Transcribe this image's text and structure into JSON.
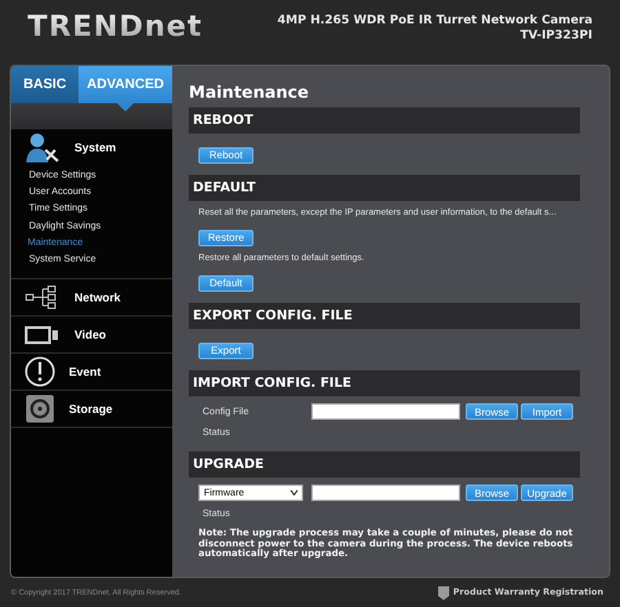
{
  "header": {
    "logo": "TRENDnet",
    "product_name": "4MP H.265 WDR PoE IR Turret Network Camera",
    "model": "TV-IP323PI"
  },
  "mode_tabs": [
    {
      "label": "BASIC",
      "selected": false
    },
    {
      "label": "ADVANCED",
      "selected": true
    }
  ],
  "sidebar": [
    {
      "label": "System",
      "children": [
        {
          "label": "Device Settings",
          "selected": false
        },
        {
          "label": "User Accounts",
          "selected": false
        },
        {
          "label": "Time Settings",
          "selected": false
        },
        {
          "label": "Daylight Savings",
          "selected": false
        },
        {
          "label": "Maintenance",
          "selected": true
        },
        {
          "label": "System Service",
          "selected": false
        }
      ]
    },
    {
      "label": "Network"
    },
    {
      "label": "Video"
    },
    {
      "label": "Event"
    },
    {
      "label": "Storage"
    }
  ],
  "page_title": "Maintenance",
  "sections": [
    {
      "title": "REBOOT",
      "rows": [
        {
          "kind": "button",
          "label": "Reboot"
        }
      ]
    },
    {
      "title": "DEFAULT",
      "rows": [
        {
          "kind": "text",
          "text": "Reset all the parameters, except the IP parameters and user information, to the default s..."
        },
        {
          "kind": "button",
          "label": "Restore"
        },
        {
          "kind": "text",
          "text": "Restore all parameters to default settings."
        },
        {
          "kind": "button",
          "label": "Default"
        }
      ]
    },
    {
      "title": "EXPORT CONFIG. FILE",
      "rows": [
        {
          "kind": "button",
          "label": "Export"
        }
      ]
    },
    {
      "title": "IMPORT CONFIG. FILE",
      "rows": [
        {
          "kind": "file",
          "label": "Config File",
          "buttons": [
            "Browse",
            "Import"
          ]
        },
        {
          "kind": "label",
          "text": "Status"
        }
      ]
    },
    {
      "title": "UPGRADE",
      "rows": [
        {
          "kind": "select_file",
          "select": "Firmware",
          "buttons": [
            "Browse",
            "Upgrade"
          ]
        },
        {
          "kind": "label",
          "text": "Status"
        },
        {
          "kind": "note",
          "text": "Note: The upgrade process may take a couple of minutes, please do not disconnect power to the camera during the process. The device reboots automatically after upgrade."
        }
      ]
    }
  ],
  "footer": {
    "copyright": "© Copyright 2017 TRENDnet. All Rights Reserved.",
    "link": "Product Warranty Registration"
  }
}
